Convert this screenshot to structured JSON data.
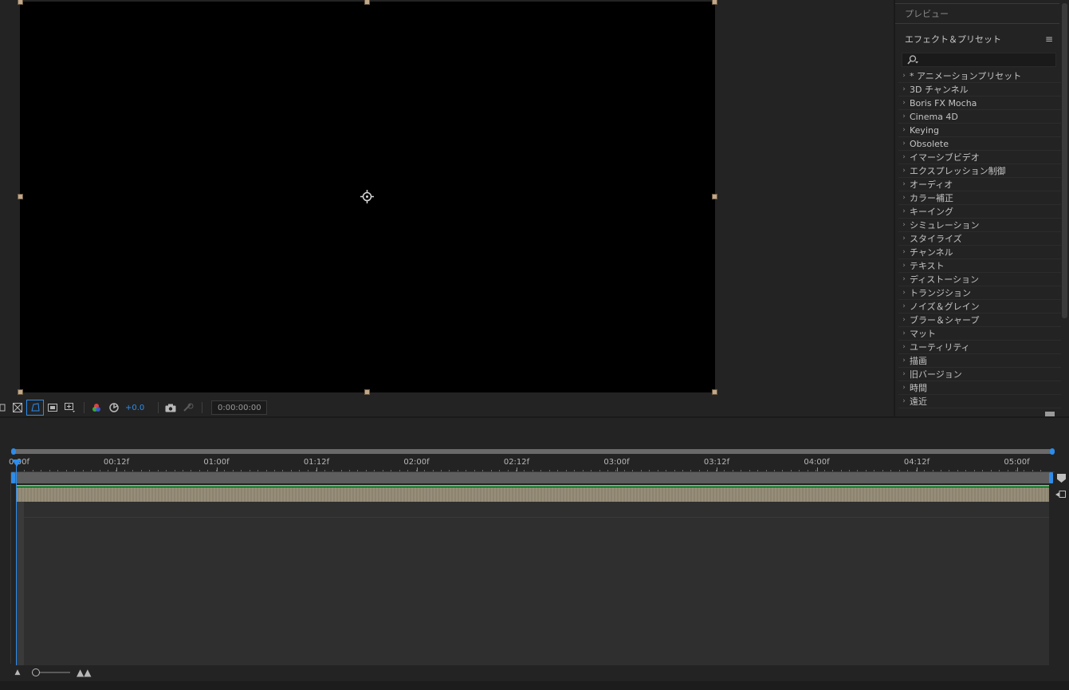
{
  "viewer": {
    "toolbar": {
      "exposure_value": "+0.0",
      "timecode": "0:00:00:00"
    }
  },
  "right_panel": {
    "preview_title": "プレビュー",
    "effects_title": "エフェクト＆プリセット",
    "menu_icon": "hamburger-icon",
    "search_placeholder": "",
    "search_icon": "search-icon",
    "items": [
      "* アニメーションプリセット",
      "3D チャンネル",
      "Boris FX Mocha",
      "Cinema 4D",
      "Keying",
      "Obsolete",
      "イマーシブビデオ",
      "エクスプレッション制御",
      "オーディオ",
      "カラー補正",
      "キーイング",
      "シミュレーション",
      "スタイライズ",
      "チャンネル",
      "テキスト",
      "ディストーション",
      "トランジション",
      "ノイズ＆グレイン",
      "ブラー＆シャープ",
      "マット",
      "ユーティリティ",
      "描画",
      "旧バージョン",
      "時間",
      "遠近"
    ]
  },
  "timeline": {
    "playhead_label": "0:00f",
    "ticks": [
      "00:12f",
      "01:00f",
      "01:12f",
      "02:00f",
      "02:12f",
      "03:00f",
      "03:12f",
      "04:00f",
      "04:12f",
      "05:00f"
    ]
  },
  "colors": {
    "accent": "#2d8ceb",
    "layer": "#928974",
    "green_line": "#3bd85a"
  }
}
